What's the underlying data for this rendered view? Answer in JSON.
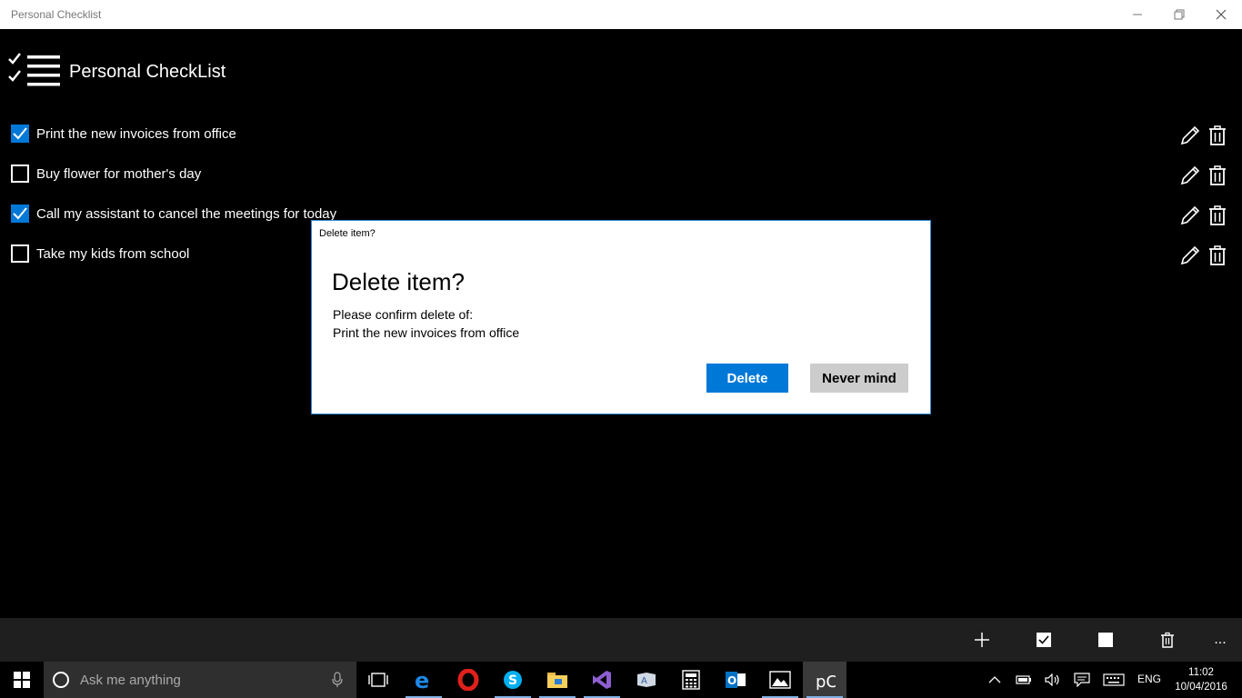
{
  "window": {
    "title": "Personal Checklist"
  },
  "app": {
    "title": "Personal CheckList"
  },
  "items": [
    {
      "text": "Print the new invoices from office",
      "checked": true
    },
    {
      "text": "Buy flower for mother's day",
      "checked": false
    },
    {
      "text": "Call my assistant to cancel the meetings for today",
      "checked": true
    },
    {
      "text": "Take my kids from school",
      "checked": false
    }
  ],
  "dialog": {
    "caption": "Delete item?",
    "title": "Delete item?",
    "message": "Please confirm delete of:",
    "item_name": "Print the new invoices from office",
    "delete_label": "Delete",
    "cancel_label": "Never mind"
  },
  "appbar": {
    "buttons": [
      "add-icon",
      "check-all-icon",
      "uncheck-all-icon",
      "delete-icon",
      "more-icon"
    ],
    "more_label": "..."
  },
  "taskbar": {
    "search_placeholder": "Ask me anything",
    "apps": [
      "task-view",
      "edge",
      "opera",
      "skype",
      "file-explorer",
      "visual-studio",
      "app",
      "calculator",
      "outlook",
      "photos",
      "personal-checklist"
    ],
    "language": "ENG",
    "time": "11:02",
    "date": "10/04/2016"
  },
  "colors": {
    "accent": "#0078d7",
    "background": "#000000",
    "appbar": "#1f1f1f",
    "dialog_border": "#2b88d8"
  }
}
